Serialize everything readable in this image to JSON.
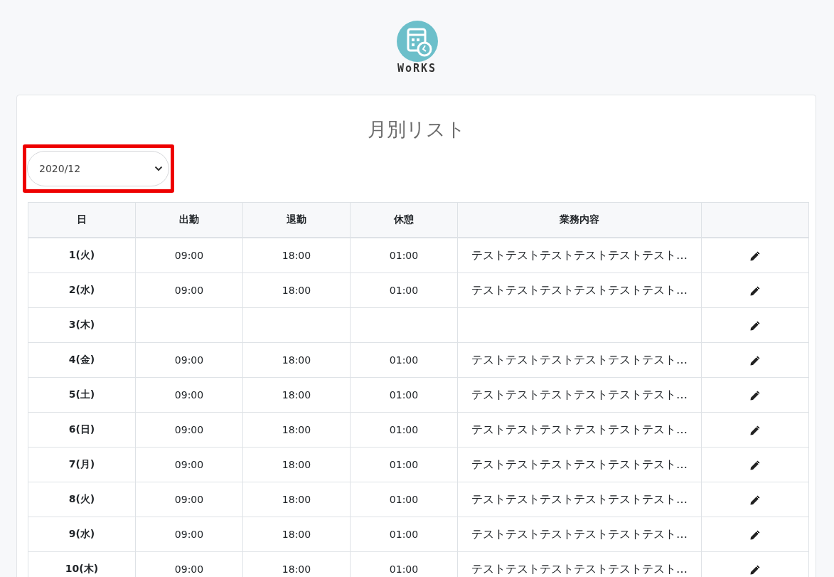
{
  "logo": {
    "text": "WoRKS"
  },
  "title": "月別リスト",
  "month_select": {
    "value": "2020/12",
    "highlighted": true
  },
  "table": {
    "columns": [
      "日",
      "出勤",
      "退勤",
      "休憩",
      "業務内容"
    ],
    "rows": [
      {
        "day": "1(火)",
        "start": "09:00",
        "end": "18:00",
        "break": "01:00",
        "work": "テストテストテストテストテストテスト…"
      },
      {
        "day": "2(水)",
        "start": "09:00",
        "end": "18:00",
        "break": "01:00",
        "work": "テストテストテストテストテストテスト…"
      },
      {
        "day": "3(木)"
      },
      {
        "day": "4(金)",
        "start": "09:00",
        "end": "18:00",
        "break": "01:00",
        "work": "テストテストテストテストテストテスト…"
      },
      {
        "day": "5(土)",
        "start": "09:00",
        "end": "18:00",
        "break": "01:00",
        "work": "テストテストテストテストテストテスト…"
      },
      {
        "day": "6(日)",
        "start": "09:00",
        "end": "18:00",
        "break": "01:00",
        "work": "テストテストテストテストテストテスト…"
      },
      {
        "day": "7(月)",
        "start": "09:00",
        "end": "18:00",
        "break": "01:00",
        "work": "テストテストテストテストテストテスト…"
      },
      {
        "day": "8(火)",
        "start": "09:00",
        "end": "18:00",
        "break": "01:00",
        "work": "テストテストテストテストテストテスト…"
      },
      {
        "day": "9(水)",
        "start": "09:00",
        "end": "18:00",
        "break": "01:00",
        "work": "テストテストテストテストテストテスト…"
      },
      {
        "day": "10(木)",
        "start": "09:00",
        "end": "18:00",
        "break": "01:00",
        "work": "テストテストテストテストテストテスト…"
      }
    ]
  }
}
